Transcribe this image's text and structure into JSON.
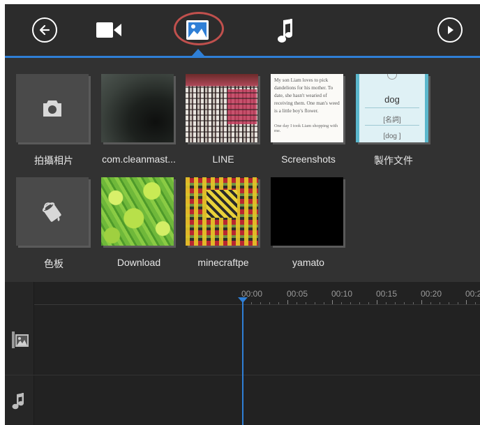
{
  "toolbar": {
    "icons": [
      "back-arrow-icon",
      "video-camera-icon",
      "image-icon",
      "music-note-icon",
      "play-icon"
    ],
    "active_tab": "image-icon",
    "accent_color": "#2f7fd6",
    "highlight_color": "#c0504d"
  },
  "gallery": {
    "folders": [
      {
        "label": "拍攝相片",
        "icon": "camera-icon"
      },
      {
        "label": "com.cleanmast..."
      },
      {
        "label": "LINE"
      },
      {
        "label": "Screenshots"
      },
      {
        "label": "製作文件"
      },
      {
        "label": "色板",
        "icon": "paint-bucket-icon"
      },
      {
        "label": "Download"
      },
      {
        "label": "minecraftpe"
      },
      {
        "label": "yamato"
      }
    ],
    "screenshot_text": "My son Liam loves to pick dandelions for his mother. To date, she hasn't wearied of receiving them. One man's weed is a little boy's flower.",
    "screenshot_text2": "One day I took Liam shopping with me.",
    "doc_word": "dog",
    "doc_tag": "[名詞]",
    "doc_tag2": "[dog ]"
  },
  "timeline": {
    "ticks": [
      "00:00",
      "00:05",
      "00:10",
      "00:15",
      "00:20",
      "00:2"
    ],
    "track_icons": [
      "video-track-icon",
      "audio-track-icon"
    ]
  }
}
